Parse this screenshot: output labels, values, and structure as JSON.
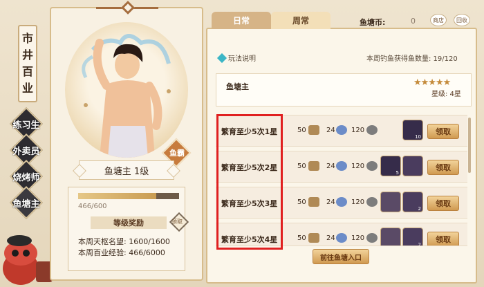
{
  "left_nav": {
    "title_chars": [
      "市",
      "井",
      "百",
      "业"
    ],
    "items": [
      {
        "label": "练习生",
        "active": false
      },
      {
        "label": "外卖员",
        "active": false
      },
      {
        "label": "烧烤师",
        "active": false
      },
      {
        "label": "鱼塘主",
        "active": true
      }
    ]
  },
  "card": {
    "tag": "鱼霸",
    "name_level": "鱼塘主   1级",
    "exp_progress": 0.0777,
    "exp_text": "466/600",
    "level_reward": "等级奖励",
    "check_text": "领取",
    "rows": [
      {
        "label": "本周天枢名望:",
        "value": "1600/1600"
      },
      {
        "label": "本周百业经验:",
        "value": "466/6000"
      }
    ]
  },
  "tabs": {
    "daily": "日常",
    "weekly": "周常"
  },
  "currency": {
    "label": "鱼塘币:",
    "value": "0"
  },
  "top_buttons": [
    "商店",
    "回收"
  ],
  "help_text": "玩法说明",
  "week_count": "本周钓鱼获得鱼数量: 19/120",
  "owner": {
    "title": "鱼塘主",
    "stars": "★★★★★",
    "star_level": "星级: 4星"
  },
  "tasks": [
    {
      "title": "繁育至少5次1星",
      "r1": "50",
      "r2": "24",
      "r3": "120",
      "items": [
        {
          "count": "10"
        }
      ],
      "claim": "领取"
    },
    {
      "title": "繁育至少5次2星",
      "r1": "50",
      "r2": "24",
      "r3": "120",
      "items": [
        {
          "count": "5"
        },
        {
          "count": ""
        }
      ],
      "claim": "领取"
    },
    {
      "title": "繁育至少5次3星",
      "r1": "50",
      "r2": "24",
      "r3": "120",
      "items": [
        {
          "count": ""
        },
        {
          "count": "2"
        }
      ],
      "claim": "领取"
    },
    {
      "title": "繁育至少5次4星",
      "r1": "50",
      "r2": "24",
      "r3": "120",
      "items": [
        {
          "count": ""
        },
        {
          "count": "2"
        }
      ],
      "claim": "领取"
    }
  ],
  "go_button": "前往鱼塘入口"
}
